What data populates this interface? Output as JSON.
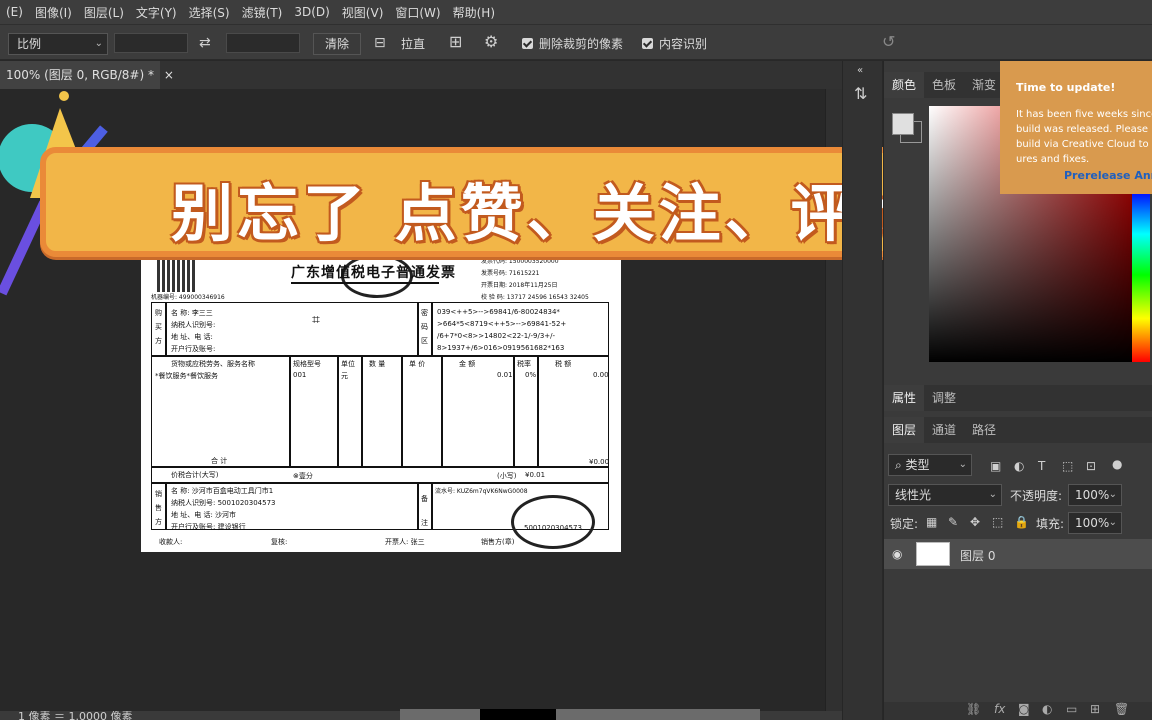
{
  "menu": [
    "图像(I)",
    "图层(L)",
    "文字(Y)",
    "选择(S)",
    "滤镜(T)",
    "3D(D)",
    "视图(V)",
    "窗口(W)",
    "帮助(H)"
  ],
  "menu_partial": "(E)",
  "options": {
    "ratio": "比例",
    "clear": "清除",
    "straighten": "拉直",
    "delete_cropped": "删除裁剪的像素",
    "content_aware": "内容识别"
  },
  "doc_tab": "100% (图层 0, RGB/8#) *",
  "status": "1 像素 ＝ 1.0000 像素",
  "banner": "别忘了 点赞、关注、评论哟！",
  "invoice": {
    "title": "广东增值税电子普通发票",
    "machine_no": "机器编号: 499000346916",
    "code": "发票代码: 1500003520000",
    "number": "发票号码: 71615221",
    "date": "开票日期: 2018年11月25日",
    "check": "校 验 码: 13717 24596 16543 32405",
    "buyer_name": "名    称: 李三三",
    "buyer_tax": "纳税人识别号:",
    "buyer_addr": "地  址、电  话:",
    "buyer_bank": "开户行及账号:",
    "cipher1": "039<++5>-->69841/6-80024834*",
    "cipher2": ">664*5<8719<++5>-->69841-52+",
    "cipher3": "/6+7*0<8>>14802<22-1/-9/3+/-",
    "cipher4": "8>1937+/6>016>0919561682*163",
    "goods_header": "货物或应税劳务、服务名称",
    "goods_item": "*餐饮服务*餐饮服务",
    "spec_header": "规格型号",
    "unit_header": "单位",
    "qty_header": "数  量",
    "price_header": "单  价",
    "amount_header": "金    额",
    "rate_header": "税率",
    "tax_header": "税    额",
    "spec_val": "001",
    "unit_val": "元",
    "amount_val": "0.01",
    "rate_val": "0%",
    "tax_val": "0.00",
    "total_label": "合    计",
    "total_val": "¥0.00",
    "total_incl_label": "价税合计(大写)",
    "total_incl_val": "⊗壹分",
    "small_label": "(小写)",
    "small_val": "¥0.01",
    "seller_name": "名    称: 沙河市百盒电动工具门市1",
    "seller_tax": "纳税人识别号: 5001020304573",
    "seller_addr": "地  址、电  话: 沙河市",
    "seller_bank": "开户行及账号: 建设银行",
    "remark": "流水号: KUZ6m7qVK6NwG0008",
    "seal_text": "5001020304573",
    "payee": "收款人:",
    "reviewer": "复核:",
    "drawer": "开票人: 张三",
    "seller_sign": "销售方(章)",
    "side_buyer": [
      "购",
      "买",
      "方"
    ],
    "side_pw": [
      "密",
      "码",
      "区"
    ],
    "side_seller": [
      "销",
      "售",
      "方"
    ],
    "side_note": [
      "备",
      "注"
    ]
  },
  "panels": {
    "color_tabs": [
      "颜色",
      "色板",
      "渐变"
    ],
    "prop_tabs": [
      "属性",
      "调整"
    ],
    "layer_tabs": [
      "图层",
      "通道",
      "路径"
    ],
    "filter": "类型",
    "blend": "线性光",
    "opacity_label": "不透明度:",
    "opacity": "100%",
    "lock_label": "锁定:",
    "fill_label": "填充:",
    "fill": "100%",
    "layer_name": "图层 0"
  },
  "popup": {
    "title": "Time to update!",
    "body": "It has been five weeks since\nbuild was released. Please in\nbuild via Creative Cloud to s\nures and fixes.",
    "link": "Prerelease Annou"
  }
}
